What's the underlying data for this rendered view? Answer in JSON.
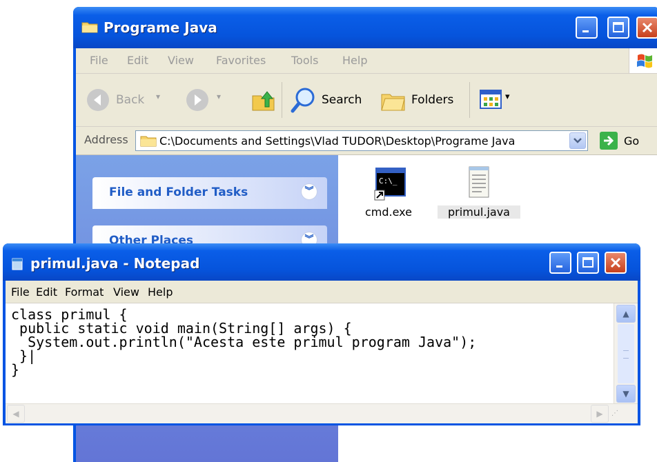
{
  "explorer": {
    "title": "Programe Java",
    "menu": [
      "File",
      "Edit",
      "View",
      "Favorites",
      "Tools",
      "Help"
    ],
    "toolbar": {
      "back_label": "Back",
      "search_label": "Search",
      "folders_label": "Folders"
    },
    "address": {
      "label": "Address",
      "value": "C:\\Documents and Settings\\Vlad TUDOR\\Desktop\\Programe Java",
      "go_label": "Go"
    },
    "tasks": [
      {
        "title": "File and Folder Tasks"
      },
      {
        "title": "Other Places"
      }
    ],
    "files": [
      {
        "name": "cmd.exe",
        "icon": "cmd-icon"
      },
      {
        "name": "primul.java",
        "icon": "notepad-file-icon",
        "selected": true
      }
    ]
  },
  "notepad": {
    "title": "primul.java - Notepad",
    "menu": [
      "File",
      "Edit",
      "Format",
      "View",
      "Help"
    ],
    "code": "class primul {\n public static void main(String[] args) {\n  System.out.println(\"Acesta este primul program Java\");\n }|\n}"
  },
  "colors": {
    "titlebar_blue": "#0054e3",
    "task_pane_blue": "#6f8fe0",
    "close_red": "#c7401d"
  }
}
